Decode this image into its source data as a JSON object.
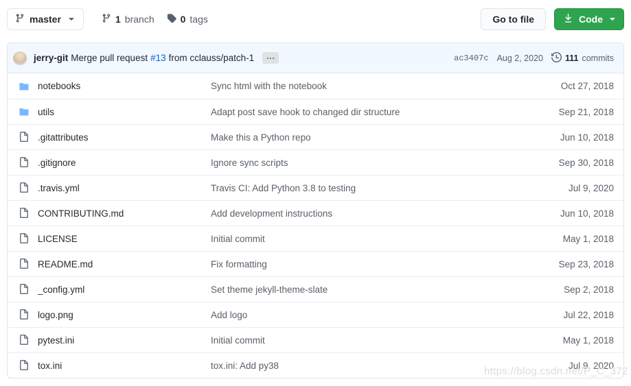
{
  "toolbar": {
    "branch_selector": {
      "label": "master",
      "icon": "branch-icon",
      "caret": "chevron-down-icon"
    },
    "branch_count": {
      "value": "1",
      "label": "branch",
      "icon": "branch-icon"
    },
    "tag_count": {
      "value": "0",
      "label": "tags",
      "icon": "tag-icon"
    },
    "go_to_file_label": "Go to file",
    "code_label": "Code",
    "code_icon": "download-icon",
    "code_color": "#2ea44f"
  },
  "commit_bar": {
    "avatar": "user-avatar",
    "author": "jerry-git",
    "message_before": "Merge pull request",
    "pr_number": "#13",
    "message_after": "from cclauss/patch-1",
    "ellipsis_label": "...",
    "sha": "ac3407c",
    "date": "Aug 2, 2020",
    "commits_count": "111",
    "commits_label": "commits",
    "commits_icon": "history-icon",
    "background": "#f1f8ff"
  },
  "files": [
    {
      "icon": "folder-icon",
      "type": "folder",
      "name": "notebooks",
      "message": "Sync html with the notebook",
      "date": "Oct 27, 2018"
    },
    {
      "icon": "folder-icon",
      "type": "folder",
      "name": "utils",
      "message": "Adapt post save hook to changed dir structure",
      "date": "Sep 21, 2018"
    },
    {
      "icon": "file-icon",
      "type": "file",
      "name": ".gitattributes",
      "message": "Make this a Python repo",
      "date": "Jun 10, 2018"
    },
    {
      "icon": "file-icon",
      "type": "file",
      "name": ".gitignore",
      "message": "Ignore sync scripts",
      "date": "Sep 30, 2018"
    },
    {
      "icon": "file-icon",
      "type": "file",
      "name": ".travis.yml",
      "message": "Travis CI: Add Python 3.8 to testing",
      "date": "Jul 9, 2020"
    },
    {
      "icon": "file-icon",
      "type": "file",
      "name": "CONTRIBUTING.md",
      "message": "Add development instructions",
      "date": "Jun 10, 2018"
    },
    {
      "icon": "file-icon",
      "type": "file",
      "name": "LICENSE",
      "message": "Initial commit",
      "date": "May 1, 2018"
    },
    {
      "icon": "file-icon",
      "type": "file",
      "name": "README.md",
      "message": "Fix formatting",
      "date": "Sep 23, 2018"
    },
    {
      "icon": "file-icon",
      "type": "file",
      "name": "_config.yml",
      "message": "Set theme jekyll-theme-slate",
      "date": "Sep 2, 2018"
    },
    {
      "icon": "file-icon",
      "type": "file",
      "name": "logo.png",
      "message": "Add logo",
      "date": "Jul 22, 2018"
    },
    {
      "icon": "file-icon",
      "type": "file",
      "name": "pytest.ini",
      "message": "Initial commit",
      "date": "May 1, 2018"
    },
    {
      "icon": "file-icon",
      "type": "file",
      "name": "tox.ini",
      "message": "tox.ini: Add py38",
      "date": "Jul 9, 2020"
    }
  ],
  "watermark": {
    "text": "https://blog.csdn.net/P_C_372"
  }
}
